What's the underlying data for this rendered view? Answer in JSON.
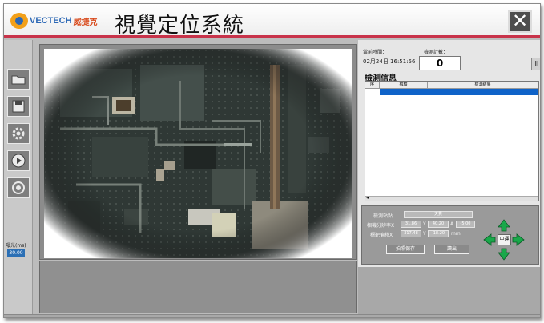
{
  "app": {
    "title": "視覺定位系統",
    "logo_text": "VECTECH",
    "logo_cn": "威捷克",
    "close_label": "✕"
  },
  "sidebar": {
    "label": "曝光(ms)",
    "value": "30.00",
    "tools": [
      "folder-icon",
      "save-icon",
      "gear-icon",
      "play-icon",
      "target-icon"
    ]
  },
  "info": {
    "time_caption": "當前時間：",
    "time_value": "02月24日 16:51:56",
    "count_caption": "檢測計數：",
    "count_value": "0",
    "side_button": "II"
  },
  "detect": {
    "title": "檢測信息",
    "columns": [
      "序",
      "檢驗",
      "檢測結果"
    ],
    "scroll_arrow": "◄"
  },
  "control": {
    "capture_label": "檢測站點",
    "capture_value": "天貫",
    "resolution_label": "相機分辨率X",
    "res_x": "31.86",
    "res_y_label": "Y",
    "res_y": "40.20",
    "res_a_label": "A",
    "res_a": "-5.00",
    "offset_label": "標靶偏移X",
    "off_x": "317.48",
    "off_y_label": "Y",
    "off_y": "-18.20",
    "off_unit": "mm",
    "btn_left": "拍照保存",
    "btn_right": "讀出",
    "center_label": "中運"
  },
  "colors": {
    "accent_line": "#c8334a",
    "selection": "#0f63c8",
    "arrow_green": "#19a84a"
  }
}
